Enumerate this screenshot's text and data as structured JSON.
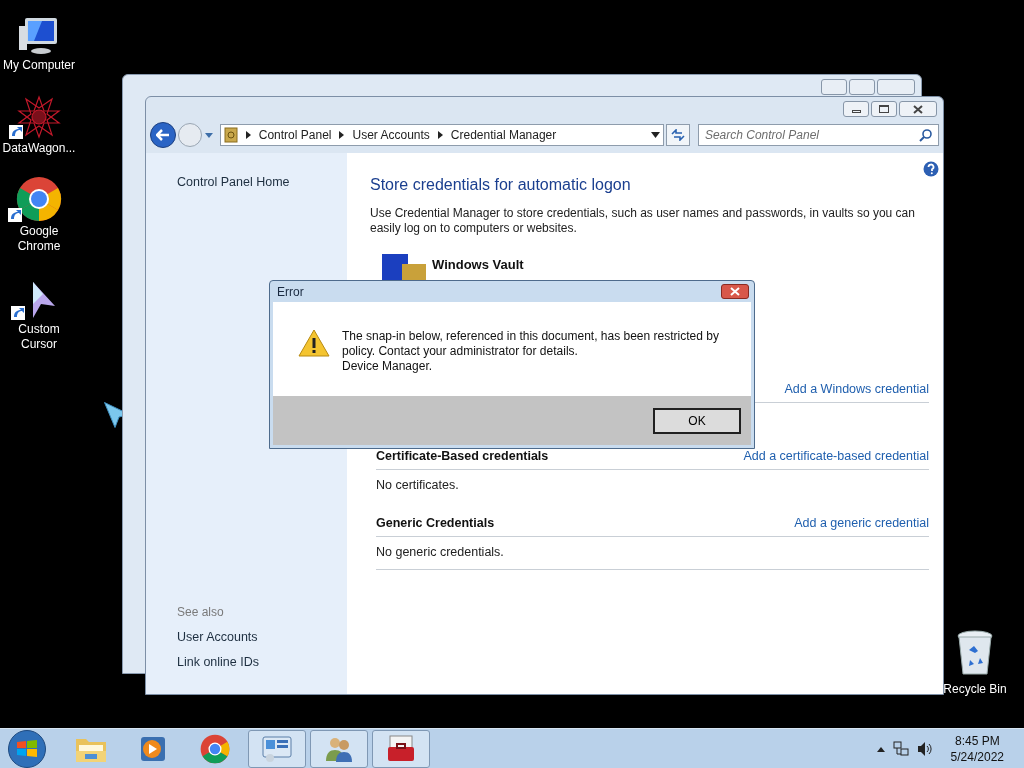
{
  "desktop_icons": [
    {
      "kind": "computer",
      "label": "My Computer"
    },
    {
      "kind": "star",
      "label": "DataWagon..."
    },
    {
      "kind": "chrome",
      "label": "Google Chrome"
    },
    {
      "kind": "cursor",
      "label": "Custom Cursor"
    },
    {
      "kind": "bin",
      "label": "Recycle Bin"
    }
  ],
  "window": {
    "breadcrumbs": [
      "Control Panel",
      "User Accounts",
      "Credential Manager"
    ],
    "search": {
      "placeholder": "Search Control Panel"
    },
    "sidebar": {
      "home_link": "Control Panel Home",
      "see_also": "See also",
      "links": [
        "User Accounts",
        "Link online IDs"
      ]
    },
    "main": {
      "title": "Store credentials for automatic logon",
      "description": "Use Credential Manager to store credentials, such as user names and passwords, in vaults so you can easily log on to computers or websites.",
      "vault_label": "Windows Vault",
      "sections": [
        {
          "link": "Add a Windows credential"
        },
        {
          "heading": "Certificate-Based credentials",
          "link": "Add a certificate-based credential",
          "empty_text": "No certificates."
        },
        {
          "heading": "Generic Credentials",
          "link": "Add a generic credential",
          "empty_text": "No generic credentials."
        }
      ]
    }
  },
  "dialog": {
    "title": "Error",
    "message": [
      "The snap-in below, referenced in this document, has been restricted by policy. Contact your administrator for details.",
      "Device Manager."
    ],
    "button": "OK"
  },
  "taskbar": {
    "items": [
      {
        "kind": "folder",
        "running": false
      },
      {
        "kind": "media",
        "running": false
      },
      {
        "kind": "chrome",
        "running": false
      },
      {
        "kind": "panel",
        "running": true
      },
      {
        "kind": "users",
        "running": true
      },
      {
        "kind": "toolbox",
        "running": true
      }
    ],
    "time": "8:45 PM",
    "date": "5/24/2022"
  }
}
